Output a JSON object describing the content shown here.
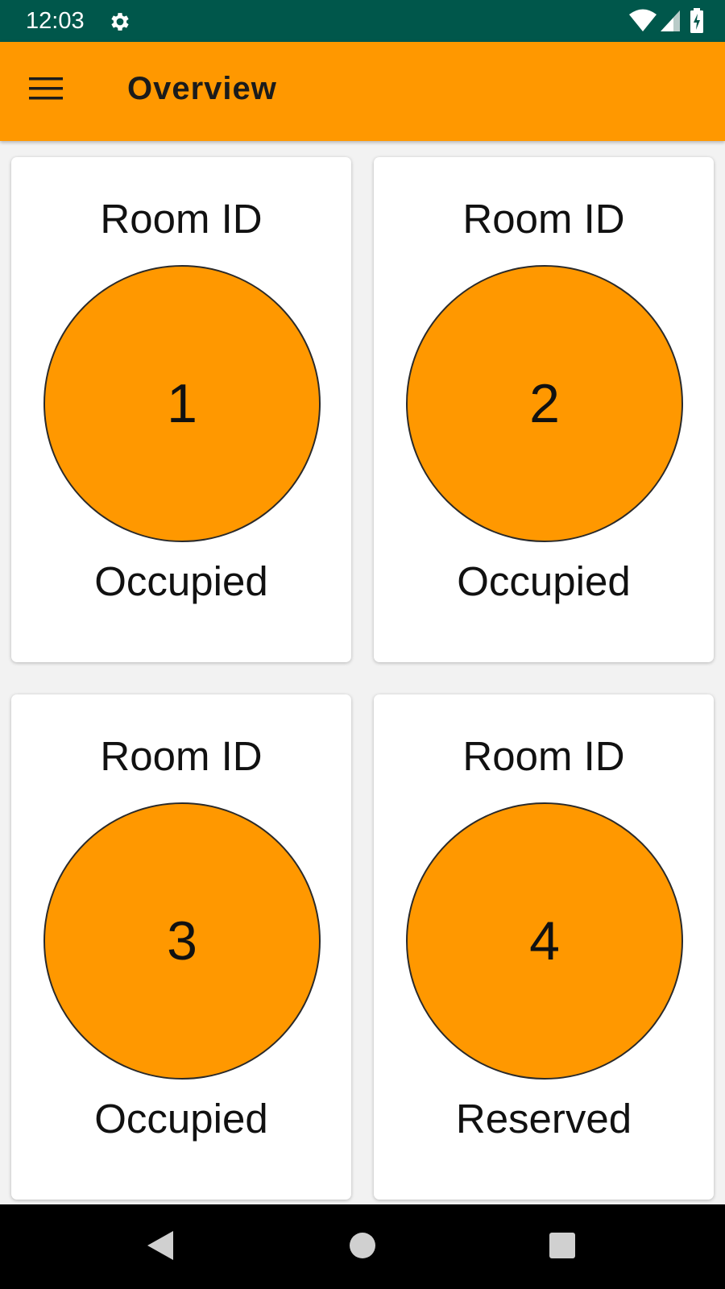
{
  "status_bar": {
    "time": "12:03",
    "icons": [
      "gear-icon",
      "wifi-icon",
      "signal-icon",
      "battery-icon"
    ],
    "background": "#00574b"
  },
  "app_bar": {
    "title": "Overview",
    "menu_icon": "hamburger-menu-icon",
    "background": "#ff9800"
  },
  "rooms": [
    {
      "label": "Room ID",
      "number": "1",
      "status": "Occupied"
    },
    {
      "label": "Room ID",
      "number": "2",
      "status": "Occupied"
    },
    {
      "label": "Room ID",
      "number": "3",
      "status": "Occupied"
    },
    {
      "label": "Room ID",
      "number": "4",
      "status": "Reserved"
    }
  ],
  "colors": {
    "accent": "#ff9800",
    "status_bar": "#00574b",
    "card": "#ffffff"
  },
  "nav_bar": {
    "buttons": [
      "back-icon",
      "home-icon",
      "recents-icon"
    ]
  }
}
